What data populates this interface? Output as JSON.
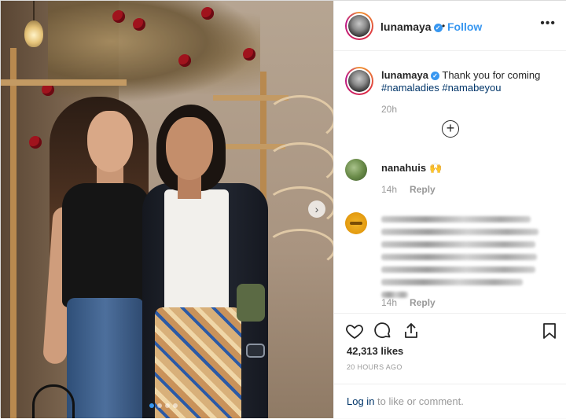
{
  "post": {
    "username": "lunamaya",
    "verified": true,
    "separator": "•",
    "follow_label": "Follow",
    "more_label": "•••",
    "caption_text": "Thank you for coming",
    "hashtags": [
      "#namaladies",
      "#namabeyou"
    ],
    "caption_time": "20h",
    "load_more_icon": "plus-circle-icon",
    "likes": "42,313 likes",
    "time_ago": "20 HOURS AGO"
  },
  "comments": [
    {
      "username": "nanahuis",
      "emoji": "🙌",
      "time": "14h",
      "reply_label": "Reply"
    },
    {
      "username": "",
      "text": "",
      "time": "14h",
      "reply_label": "Reply"
    }
  ],
  "login": {
    "link_label": "Log in",
    "rest_text": " to like or comment."
  },
  "carousel": {
    "next_icon": "chevron-right-icon",
    "slides": 4,
    "active_index": 0
  },
  "colors": {
    "accent": "#3897f0",
    "text": "#262626",
    "muted": "#999999",
    "hashtag": "#003569"
  }
}
